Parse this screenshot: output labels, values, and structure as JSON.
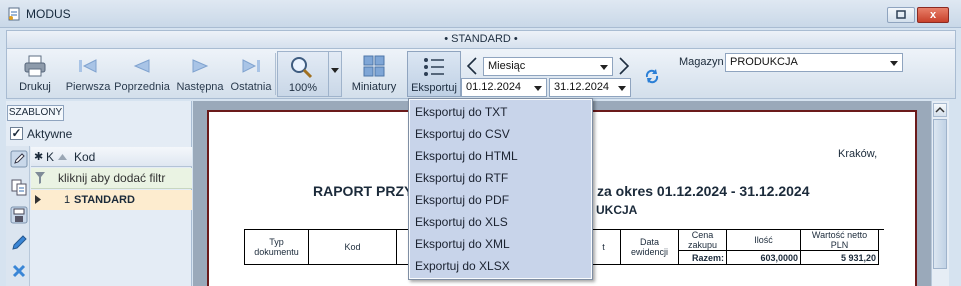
{
  "window": {
    "title": "MODUS",
    "close_glyph": "x"
  },
  "profile_bar": {
    "label": "• STANDARD •"
  },
  "toolbar": {
    "print": "Drukuj",
    "first": "Pierwsza",
    "previous": "Poprzednia",
    "next": "Następna",
    "last": "Ostatnia",
    "zoom": "100%",
    "thumbnails": "Miniatury",
    "export": "Eksportuj"
  },
  "period": {
    "type": "Miesiąc",
    "date_from": "01.12.2024",
    "date_to": "31.12.2024"
  },
  "warehouse": {
    "label": "Magazyn",
    "value": "PRODUKCJA"
  },
  "left_panel": {
    "templates_tab": "SZABLONY",
    "active_label": "Aktywne",
    "active_checked": true,
    "grid": {
      "col_k": "K",
      "col_code": "Kod",
      "filter_placeholder": "kliknij aby dodać filtr",
      "rows": [
        {
          "no": "1",
          "code": "STANDARD"
        }
      ]
    }
  },
  "report": {
    "city": "Kraków,",
    "title_left": "RAPORT PRZY",
    "title_right": "za okres 01.12.2024 - 31.12.2024",
    "subtitle": "UKCJA",
    "headers": [
      "Typ dokumentu",
      "Kod",
      "",
      "t",
      "Data ewidencji",
      "Cena zakupu",
      "Ilość",
      "Wartość netto PLN"
    ],
    "total_label": "Razem:",
    "total_qty": "603,0000",
    "total_value": "5 931,20"
  },
  "export_menu": {
    "items": [
      "Eksportuj do TXT",
      "Eksportuj do CSV",
      "Eksportuj do HTML",
      "Eksportuj do RTF",
      "Eksportuj do PDF",
      "Eksportuj do XLS",
      "Eksportuj do XML",
      "Exportuj do XLSX"
    ]
  }
}
